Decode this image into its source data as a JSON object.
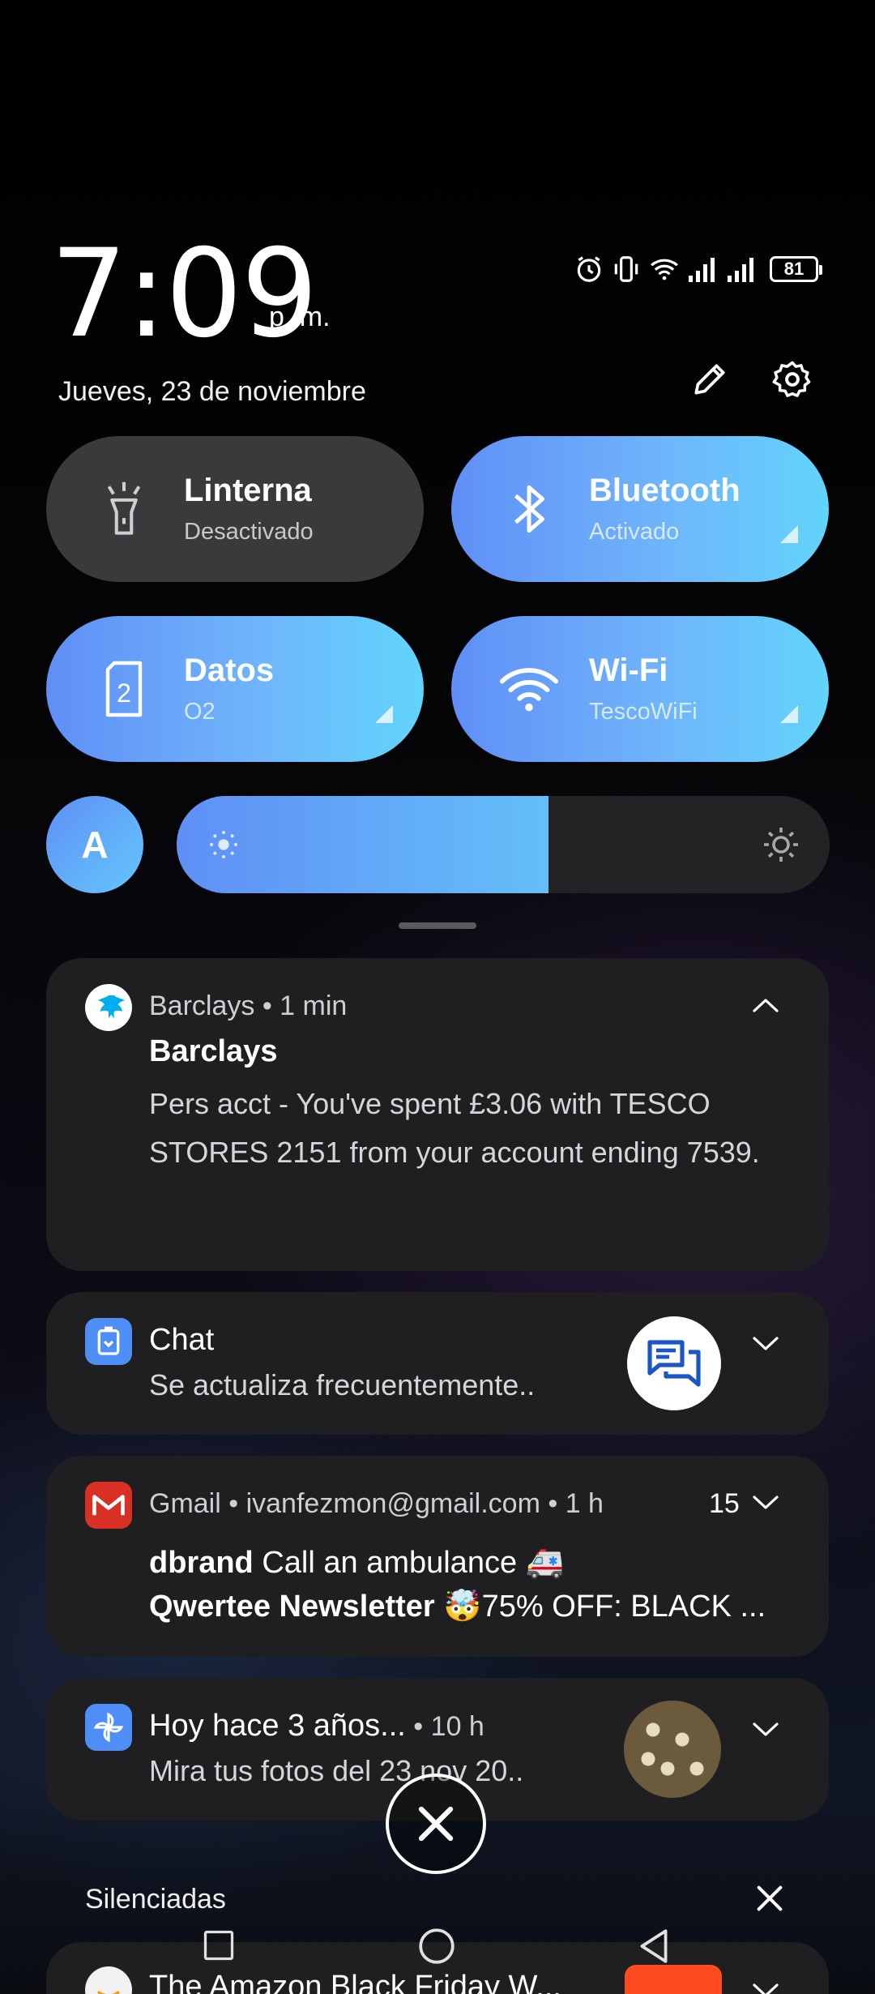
{
  "header": {
    "time": "7:09",
    "ampm": "p. m.",
    "date": "Jueves, 23 de noviembre",
    "battery": "81"
  },
  "tiles": [
    {
      "title": "Linterna",
      "subtitle": "Desactivado",
      "icon": "flashlight-icon",
      "active": false
    },
    {
      "title": "Bluetooth",
      "subtitle": "Activado",
      "icon": "bluetooth-icon",
      "active": true
    },
    {
      "title": "Datos",
      "subtitle": "O2",
      "icon": "sim-card-icon",
      "active": true
    },
    {
      "title": "Wi-Fi",
      "subtitle": "TescoWiFi",
      "icon": "wifi-icon",
      "active": true
    }
  ],
  "brightness": {
    "auto_label": "A",
    "level": 0.57
  },
  "notifications": {
    "barclays": {
      "app": "Barclays",
      "time": "1 min",
      "title": "Barclays",
      "body": "Pers acct - You've spent £3.06 with TESCO STORES 2151 from your account ending 7539."
    },
    "chat": {
      "app": "Chat",
      "body": "Se actualiza frecuentemente.."
    },
    "gmail": {
      "app": "Gmail",
      "account": "ivanfezmon@gmail.com",
      "time": "1 h",
      "count": "15",
      "line1_sender": "dbrand",
      "line1_subject": "Call an ambulance 🚑",
      "line2_sender": "Qwertee Newsletter",
      "line2_subject": "🤯75% OFF: BLACK ..."
    },
    "photos": {
      "title": "Hoy hace 3 años...",
      "time": "10 h",
      "body": "Mira tus fotos del 23 nov 20.."
    },
    "amazon": {
      "title": "The Amazon Black Friday W..."
    }
  },
  "silenced_label": "Silenciadas",
  "colors": {
    "accent_start": "#5f8ff6",
    "accent_end": "#62d4fb",
    "card_bg": "#1f1f21",
    "tile_off": "#3a3a3c"
  }
}
